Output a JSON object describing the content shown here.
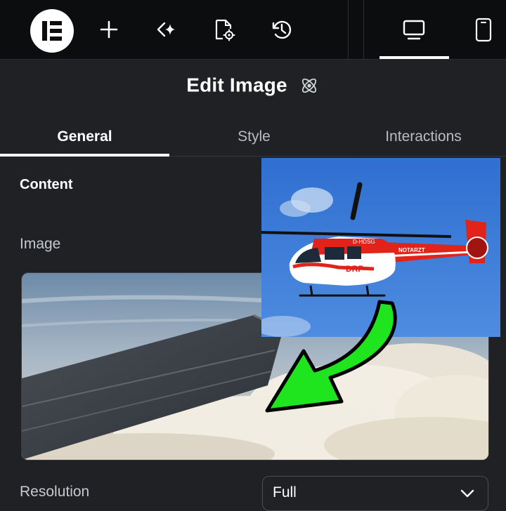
{
  "topbar": {
    "logo_icon": "elementor-logo-icon",
    "add_icon": "plus-icon",
    "ai_icon": "sparkle-icon",
    "page_settings_icon": "document-gear-icon",
    "history_icon": "history-icon",
    "desktop_icon": "desktop-icon",
    "mobile_icon": "mobile-icon",
    "active_device": "desktop"
  },
  "panel": {
    "title": "Edit Image",
    "title_icon": "atom-icon",
    "tabs": [
      {
        "label": "General",
        "active": true
      },
      {
        "label": "Style",
        "active": false
      },
      {
        "label": "Interactions",
        "active": false
      }
    ],
    "section_title": "Content",
    "image_label": "Image",
    "image_preview": "airplane-wing-above-clouds",
    "resolution_label": "Resolution",
    "resolution_value": "Full"
  },
  "overlay": {
    "photo": "red-white-helicopter",
    "helicopter_texts": {
      "registration": "D-HDSG",
      "tail_marking": "NOTARZT",
      "logo": "DRF"
    },
    "arrow": "green-arrow-icon"
  },
  "colors": {
    "panel_bg": "#1f2124",
    "topbar_bg": "#0c0d0e",
    "accent_green": "#1fe51f",
    "helicopter_red": "#e2231a"
  }
}
